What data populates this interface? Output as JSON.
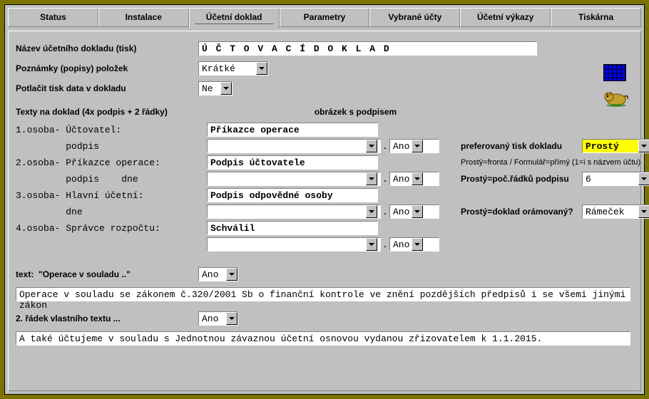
{
  "tabs": [
    "Status",
    "Instalace",
    "Účetní doklad",
    "Parametry",
    "Vybrané účty",
    "Účetní výkazy",
    "Tiskárna"
  ],
  "active_tab": 2,
  "labels": {
    "doc_name": "Název účetního dokladu (tisk)",
    "notes": "Poznámky (popisy) položek",
    "suppress_date": "Potlačit tisk data v dokladu",
    "texts_header": "Texty na doklad (4x podpis + 2 řádky)",
    "img_w_sig": "obrázek s podpisem",
    "p1a": "1.osoba- Účtovatel:",
    "p1b": "         podpis",
    "p2a": "2.osoba- Příkazce operace:",
    "p2b": "         podpis    dne",
    "p3a": "3.osoba- Hlavní účetní:",
    "p3b": "         dne",
    "p4a": "4.osoba- Správce rozpočtu:",
    "pref_print": "preferovaný tisk dokladu",
    "pref_hint": "Prostý=fronta / Formulář=přímý (1=i s názvem účtu)",
    "rows_sig": "Prostý=poč.řádků podpisu",
    "framed": "Prostý=doklad orámovaný?",
    "text1_lbl": "text:  \"Operace v souladu ..\"",
    "text2_lbl": "2. řádek vlastního textu  ..."
  },
  "values": {
    "doc_name": "Ú Č T O V A C Í   D O K L A D",
    "notes": "Krátké",
    "suppress_date": "Ne",
    "p1a": "Příkazce operace",
    "sig1": "",
    "img1": "Ano",
    "p2a": "Podpis účtovatele",
    "sig2": "",
    "img2": "Ano",
    "p3a": "Podpis odpovědné osoby",
    "sig3": "",
    "img3": "Ano",
    "p4a": "Schválil",
    "sig4": "",
    "img4": "Ano",
    "pref_print": "Prostý",
    "rows_sig": "6",
    "framed": "Rámeček",
    "text1_yn": "Ano",
    "text1": "Operace v souladu se zákonem č.320/2001 Sb o finanční kontrole ve znění pozdějších předpisů i se všemi jinými zákon",
    "text2_yn": "Ano",
    "text2": "A také účtujeme v souladu s Jednotnou závaznou účetní osnovou vydanou zřizovatelem k 1.1.2015."
  }
}
